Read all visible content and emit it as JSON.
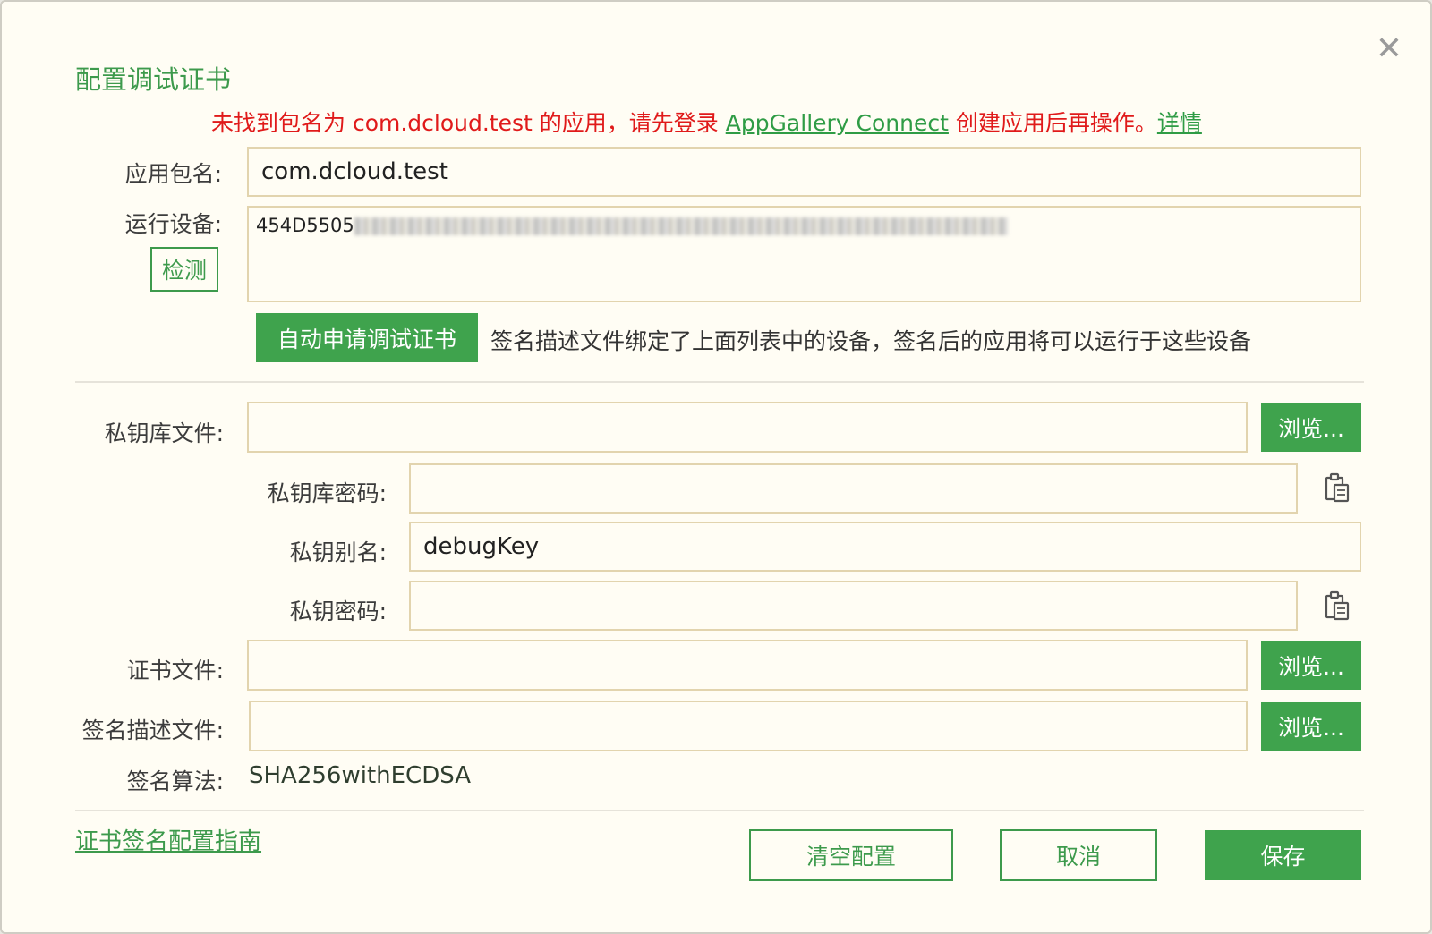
{
  "dialog": {
    "title": "配置调试证书",
    "close_glyph": "✕"
  },
  "error": {
    "prefix": "未找到包名为 com.dcloud.test 的应用，请先登录 ",
    "link": "AppGallery Connect",
    "suffix": " 创建应用后再操作。",
    "details_link": "详情"
  },
  "package": {
    "label": "应用包名:",
    "value": "com.dcloud.test"
  },
  "device": {
    "label": "运行设备:",
    "value_visible": "454D5505",
    "detect_button": "检测"
  },
  "auto_apply": {
    "button": "自动申请调试证书",
    "note": "签名描述文件绑定了上面列表中的设备，签名后的应用将可以运行于这些设备"
  },
  "keystore_file": {
    "label": "私钥库文件:",
    "value": "",
    "browse": "浏览..."
  },
  "keystore_password": {
    "label": "私钥库密码:",
    "value": "",
    "paste_icon": "clipboard-icon"
  },
  "key_alias": {
    "label": "私钥别名:",
    "value": "debugKey"
  },
  "key_password": {
    "label": "私钥密码:",
    "value": "",
    "paste_icon": "clipboard-icon"
  },
  "cert_file": {
    "label": "证书文件:",
    "value": "",
    "browse": "浏览..."
  },
  "profile_file": {
    "label": "签名描述文件:",
    "value": "",
    "browse": "浏览..."
  },
  "algorithm": {
    "label": "签名算法:",
    "value": "SHA256withECDSA"
  },
  "footer": {
    "guide_link": "证书签名配置指南",
    "clear_button": "清空配置",
    "cancel_button": "取消",
    "save_button": "保存"
  },
  "colors": {
    "accent_green": "#3fa34d",
    "error_red": "#e01a1a",
    "field_border": "#e2d4ae",
    "background": "#fffdf4"
  }
}
